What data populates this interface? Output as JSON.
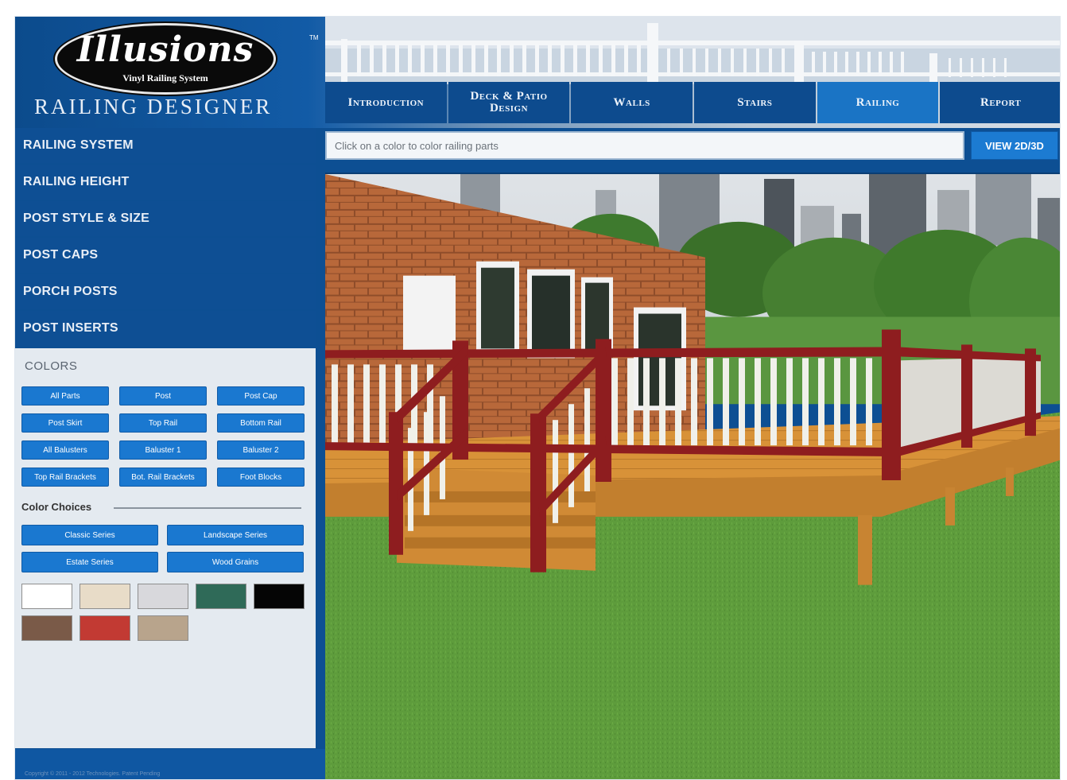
{
  "header": {
    "logo_text": "Illusions",
    "logo_subtext": "Vinyl Railing System",
    "logo_trademark": "TM",
    "app_title": "RAILING DESIGNER"
  },
  "tabs": [
    {
      "label": "Introduction",
      "active": false
    },
    {
      "label": "Deck & Patio Design",
      "active": false
    },
    {
      "label": "Walls",
      "active": false
    },
    {
      "label": "Stairs",
      "active": false
    },
    {
      "label": "Railing",
      "active": true
    },
    {
      "label": "Report",
      "active": false
    }
  ],
  "sidebar": {
    "items": [
      {
        "label": "RAILING SYSTEM"
      },
      {
        "label": "RAILING HEIGHT"
      },
      {
        "label": "POST STYLE & SIZE"
      },
      {
        "label": "POST CAPS"
      },
      {
        "label": "PORCH POSTS"
      },
      {
        "label": "POST INSERTS"
      }
    ]
  },
  "colors_panel": {
    "heading": "COLORS",
    "parts": [
      "All Parts",
      "Post",
      "Post Cap",
      "Post Skirt",
      "Top Rail",
      "Bottom Rail",
      "All Balusters",
      "Baluster 1",
      "Baluster 2",
      "Top Rail Brackets",
      "Bot. Rail Brackets",
      "Foot Blocks"
    ],
    "choices_heading": "Color Choices",
    "series": [
      "Classic Series",
      "Landscape Series",
      "Estate Series",
      "Wood Grains"
    ],
    "swatches": [
      "#ffffff",
      "#e8dcc8",
      "#d8d8dc",
      "#2f6a58",
      "#050505",
      "#7a5a48",
      "#c23a33",
      "#b8a48c"
    ]
  },
  "toolbar": {
    "instruction": "Click on a color to color railing parts",
    "view_button": "VIEW 2D/3D"
  },
  "footer": {
    "copyright": "Copyright © 2011 - 2012 Technologies. Patent Pending"
  },
  "colors": {
    "brand_blue": "#0d4f93",
    "active_tab": "#1a74c5",
    "button_blue": "#1a78d0",
    "railing_red": "#8e1d1f",
    "deck_wood": "#d9933a",
    "grass": "#5a9a3a"
  }
}
